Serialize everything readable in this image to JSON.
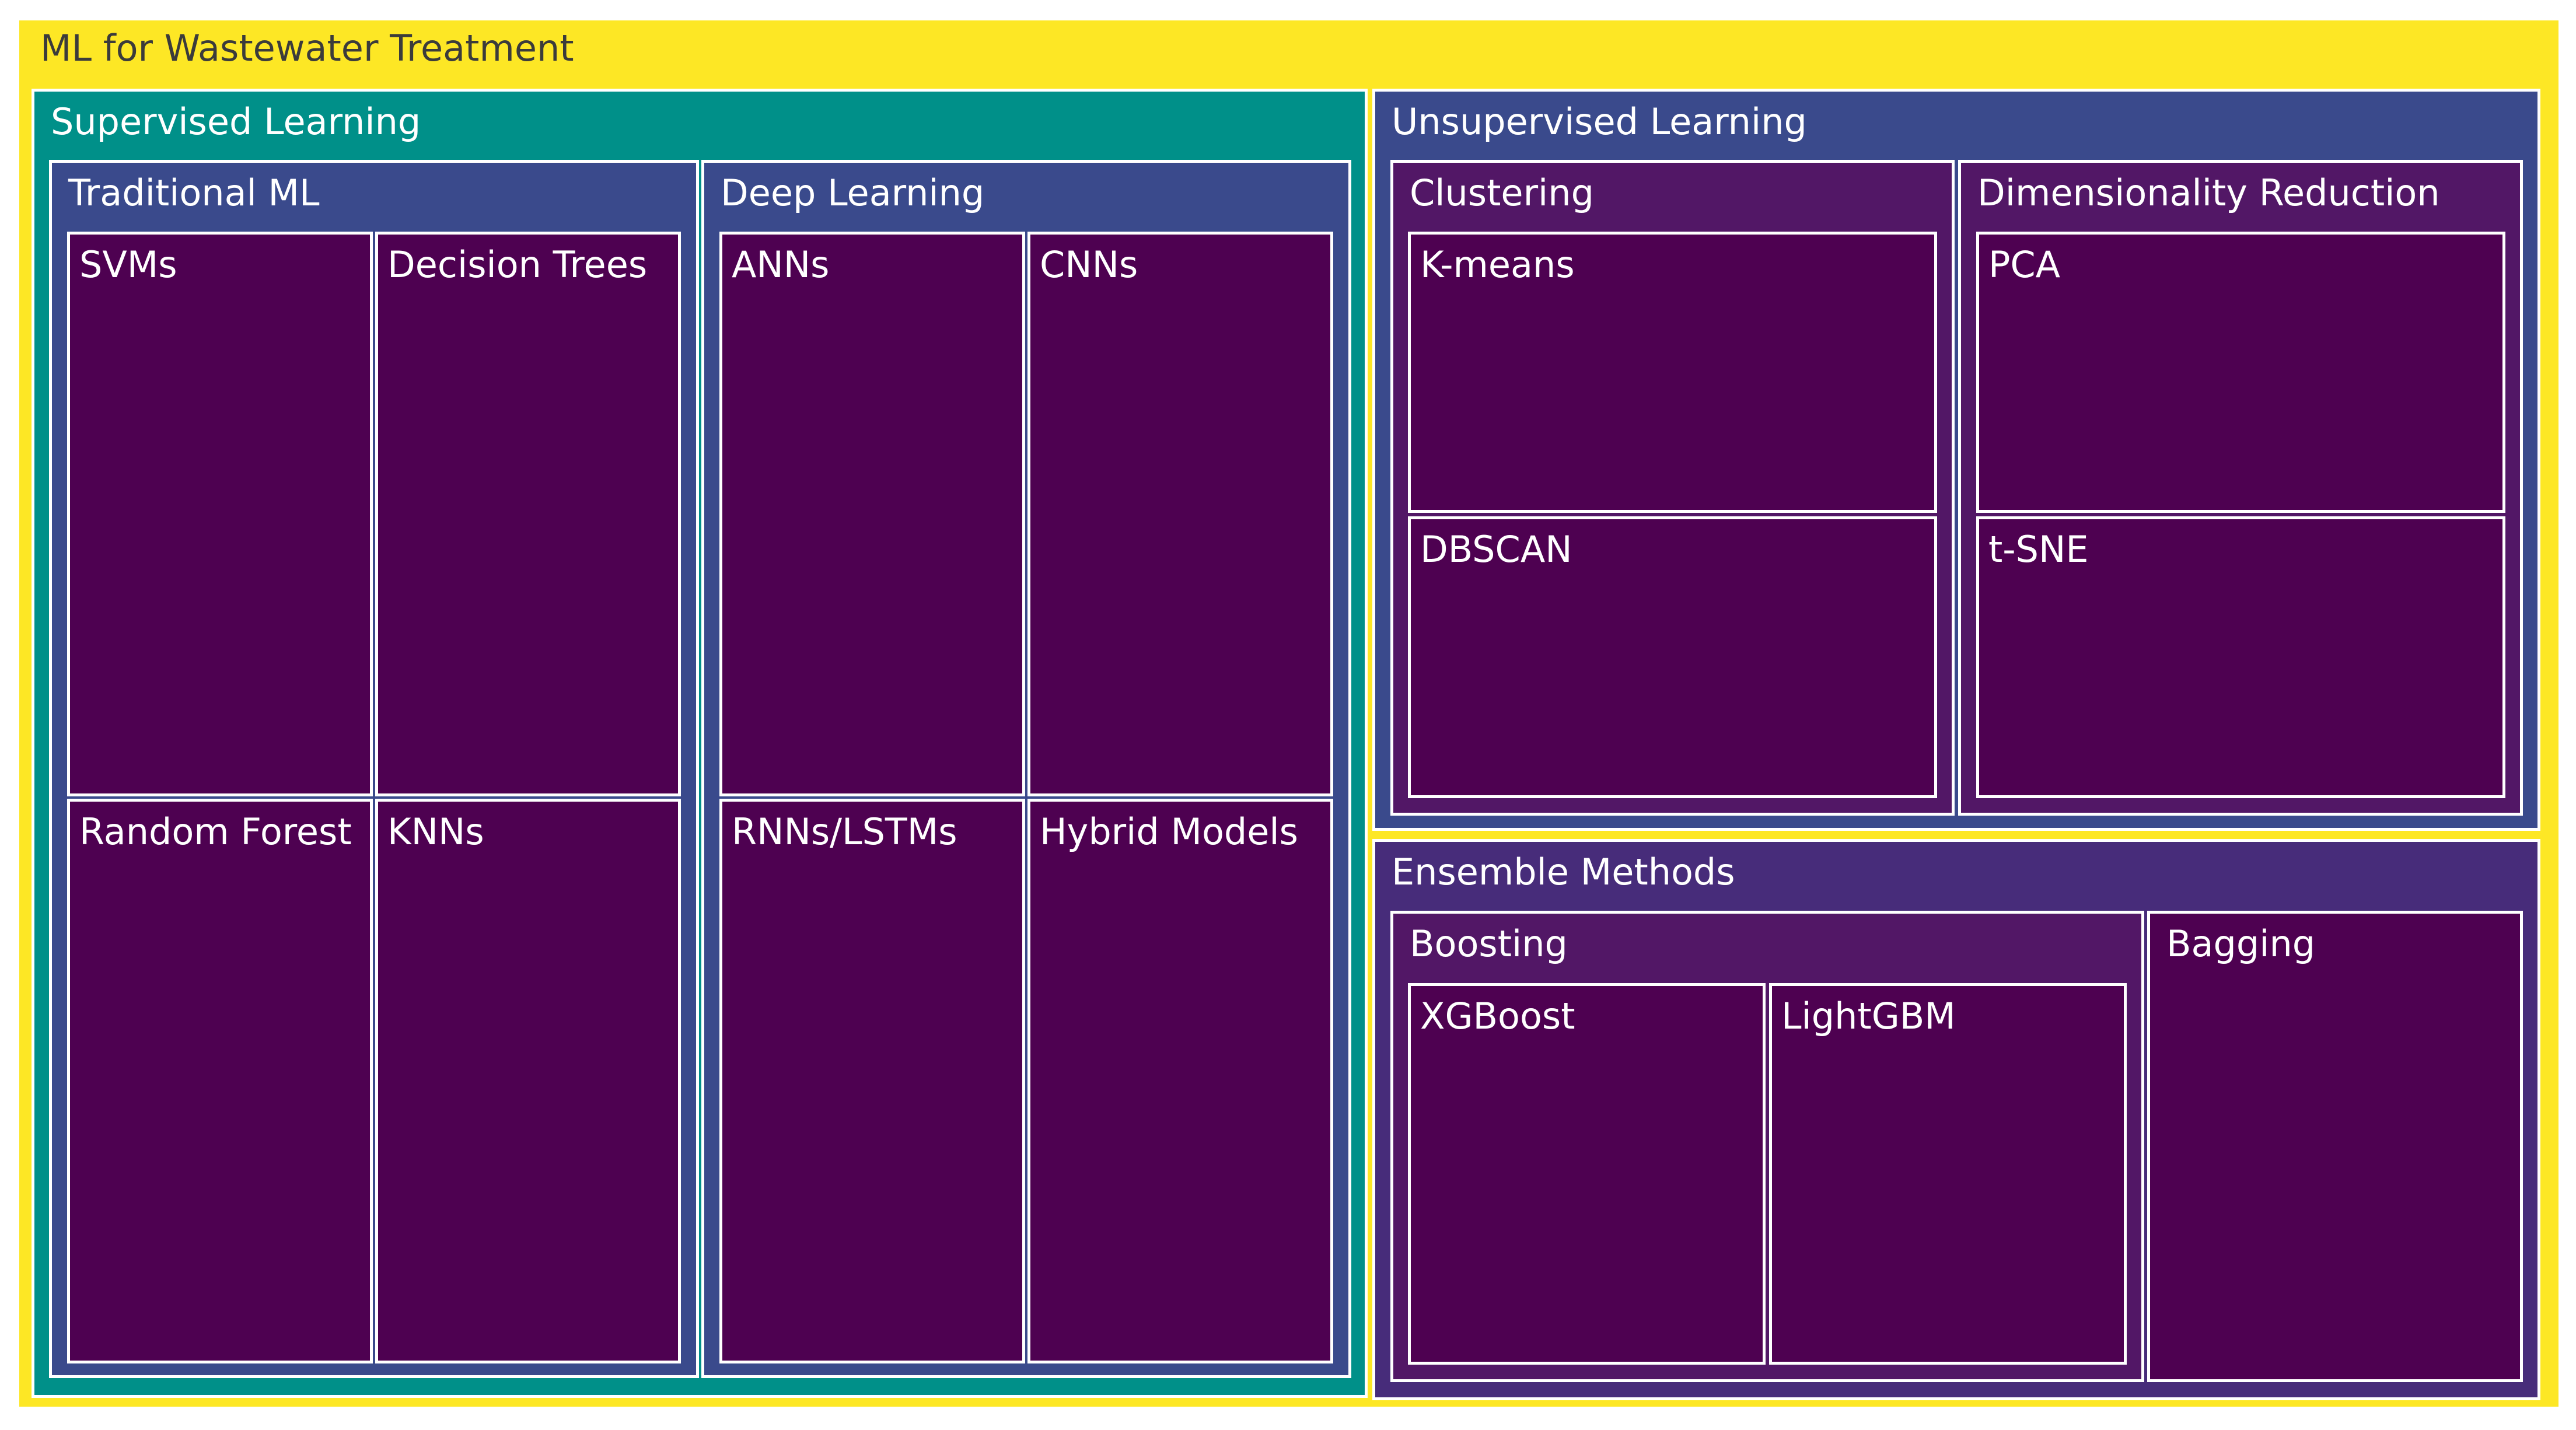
{
  "chart_data": {
    "type": "treemap",
    "root": {
      "label": "ML for Wastewater Treatment",
      "color": "#fde725",
      "children": [
        {
          "label": "Supervised Learning",
          "color": "#009089",
          "children": [
            {
              "label": "Traditional ML",
              "color": "#3a4a8c",
              "children": [
                {
                  "label": "SVMs",
                  "color": "#4e0151"
                },
                {
                  "label": "Decision Trees",
                  "color": "#4e0151"
                },
                {
                  "label": "Random Forest",
                  "color": "#4e0151"
                },
                {
                  "label": "KNNs",
                  "color": "#4e0151"
                }
              ]
            },
            {
              "label": "Deep Learning",
              "color": "#3a4a8c",
              "children": [
                {
                  "label": "ANNs",
                  "color": "#4e0151"
                },
                {
                  "label": "CNNs",
                  "color": "#4e0151"
                },
                {
                  "label": "RNNs/LSTMs",
                  "color": "#4e0151"
                },
                {
                  "label": "Hybrid Models",
                  "color": "#4e0151"
                }
              ]
            }
          ]
        },
        {
          "label": "Unsupervised Learning",
          "color": "#3a4a8c",
          "children": [
            {
              "label": "Clustering",
              "color": "#521766",
              "children": [
                {
                  "label": "K-means",
                  "color": "#4e0151"
                },
                {
                  "label": "DBSCAN",
                  "color": "#4e0151"
                }
              ]
            },
            {
              "label": "Dimensionality Reduction",
              "color": "#521766",
              "children": [
                {
                  "label": "PCA",
                  "color": "#4e0151"
                },
                {
                  "label": "t-SNE",
                  "color": "#4e0151"
                }
              ]
            }
          ]
        },
        {
          "label": "Ensemble Methods",
          "color": "#472c7a",
          "children": [
            {
              "label": "Boosting",
              "color": "#521766",
              "children": [
                {
                  "label": "XGBoost",
                  "color": "#4e0151"
                },
                {
                  "label": "LightGBM",
                  "color": "#4e0151"
                }
              ]
            },
            {
              "label": "Bagging",
              "color": "#4e0151"
            }
          ]
        }
      ]
    }
  }
}
